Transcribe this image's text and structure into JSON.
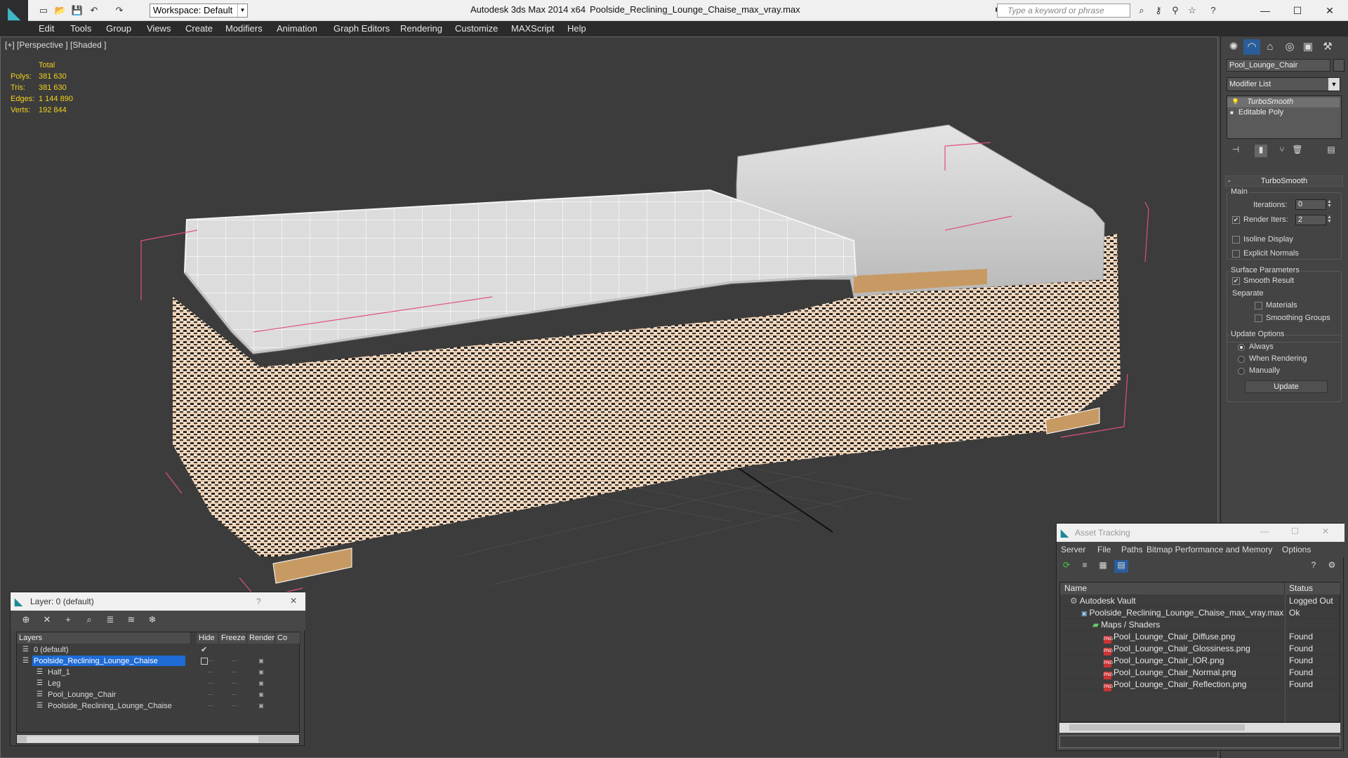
{
  "titlebar": {
    "workspace": "Workspace: Default",
    "app_title": "Autodesk 3ds Max  2014 x64",
    "file_title": "Poolside_Reclining_Lounge_Chaise_max_vray.max",
    "search_placeholder": "Type a keyword or phrase"
  },
  "menu": [
    "Edit",
    "Tools",
    "Group",
    "Views",
    "Create",
    "Modifiers",
    "Animation",
    "Graph Editors",
    "Rendering",
    "Customize",
    "MAXScript",
    "Help"
  ],
  "viewport": {
    "label": "[+] [Perspective ] [Shaded ]",
    "stats": {
      "header": "Total",
      "polys_label": "Polys:",
      "polys": "381 630",
      "tris_label": "Tris:",
      "tris": "381 630",
      "edges_label": "Edges:",
      "edges": "1 144 890",
      "verts_label": "Verts:",
      "verts": "192 844"
    }
  },
  "command_panel": {
    "object_name": "Pool_Lounge_Chair",
    "modifier_list": "Modifier List",
    "stack": [
      "TurboSmooth",
      "Editable Poly"
    ],
    "rollout_title": "TurboSmooth",
    "main_group": "Main",
    "iterations_label": "Iterations:",
    "iterations": "0",
    "render_iters_label": "Render Iters:",
    "render_iters": "2",
    "render_iters_checked": true,
    "isoline_display": "Isoline Display",
    "explicit_normals": "Explicit Normals",
    "surface_group": "Surface Parameters",
    "smooth_result": "Smooth Result",
    "separate": "Separate",
    "materials": "Materials",
    "smoothing_groups": "Smoothing Groups",
    "update_group": "Update Options",
    "always": "Always",
    "when_rendering": "When Rendering",
    "manually": "Manually",
    "update_button": "Update"
  },
  "layer_dialog": {
    "title": "Layer: 0 (default)",
    "help": "?",
    "headers": [
      "Layers",
      "Hide",
      "Freeze",
      "Render",
      "Co"
    ],
    "rows": [
      {
        "name": "0 (default)",
        "indent": 0,
        "current": true
      },
      {
        "name": "Poolside_Reclining_Lounge_Chaise",
        "indent": 0,
        "selected": true
      },
      {
        "name": "Half_1",
        "indent": 1
      },
      {
        "name": "Leg",
        "indent": 1
      },
      {
        "name": "Pool_Lounge_Chair",
        "indent": 1
      },
      {
        "name": "Poolside_Reclining_Lounge_Chaise",
        "indent": 1
      }
    ]
  },
  "asset_tracking": {
    "title": "Asset Tracking",
    "menu": [
      "Server",
      "File",
      "Paths",
      "Bitmap Performance and Memory",
      "Options"
    ],
    "headers": [
      "Name",
      "Status"
    ],
    "rows": [
      {
        "name": "Autodesk Vault",
        "status": "Logged Out",
        "indent": 1,
        "icon": "vault"
      },
      {
        "name": "Poolside_Reclining_Lounge_Chaise_max_vray.max",
        "status": "Ok",
        "indent": 2,
        "icon": "max"
      },
      {
        "name": "Maps / Shaders",
        "status": "",
        "indent": 3,
        "icon": "maps"
      },
      {
        "name": "Pool_Lounge_Chair_Diffuse.png",
        "status": "Found",
        "indent": 4,
        "icon": "png"
      },
      {
        "name": "Pool_Lounge_Chair_Glossiness.png",
        "status": "Found",
        "indent": 4,
        "icon": "png"
      },
      {
        "name": "Pool_Lounge_Chair_IOR.png",
        "status": "Found",
        "indent": 4,
        "icon": "png"
      },
      {
        "name": "Pool_Lounge_Chair_Normal.png",
        "status": "Found",
        "indent": 4,
        "icon": "png"
      },
      {
        "name": "Pool_Lounge_Chair_Reflection.png",
        "status": "Found",
        "indent": 4,
        "icon": "png"
      }
    ]
  },
  "colors": {
    "viewport_bg": "#3c3c3c",
    "stats_text": "#f2d21f",
    "selection": "#1e6bd6",
    "wicker": "#e8c8a8",
    "cushion": "#d9d9d9",
    "bbox": "#e0507a"
  }
}
